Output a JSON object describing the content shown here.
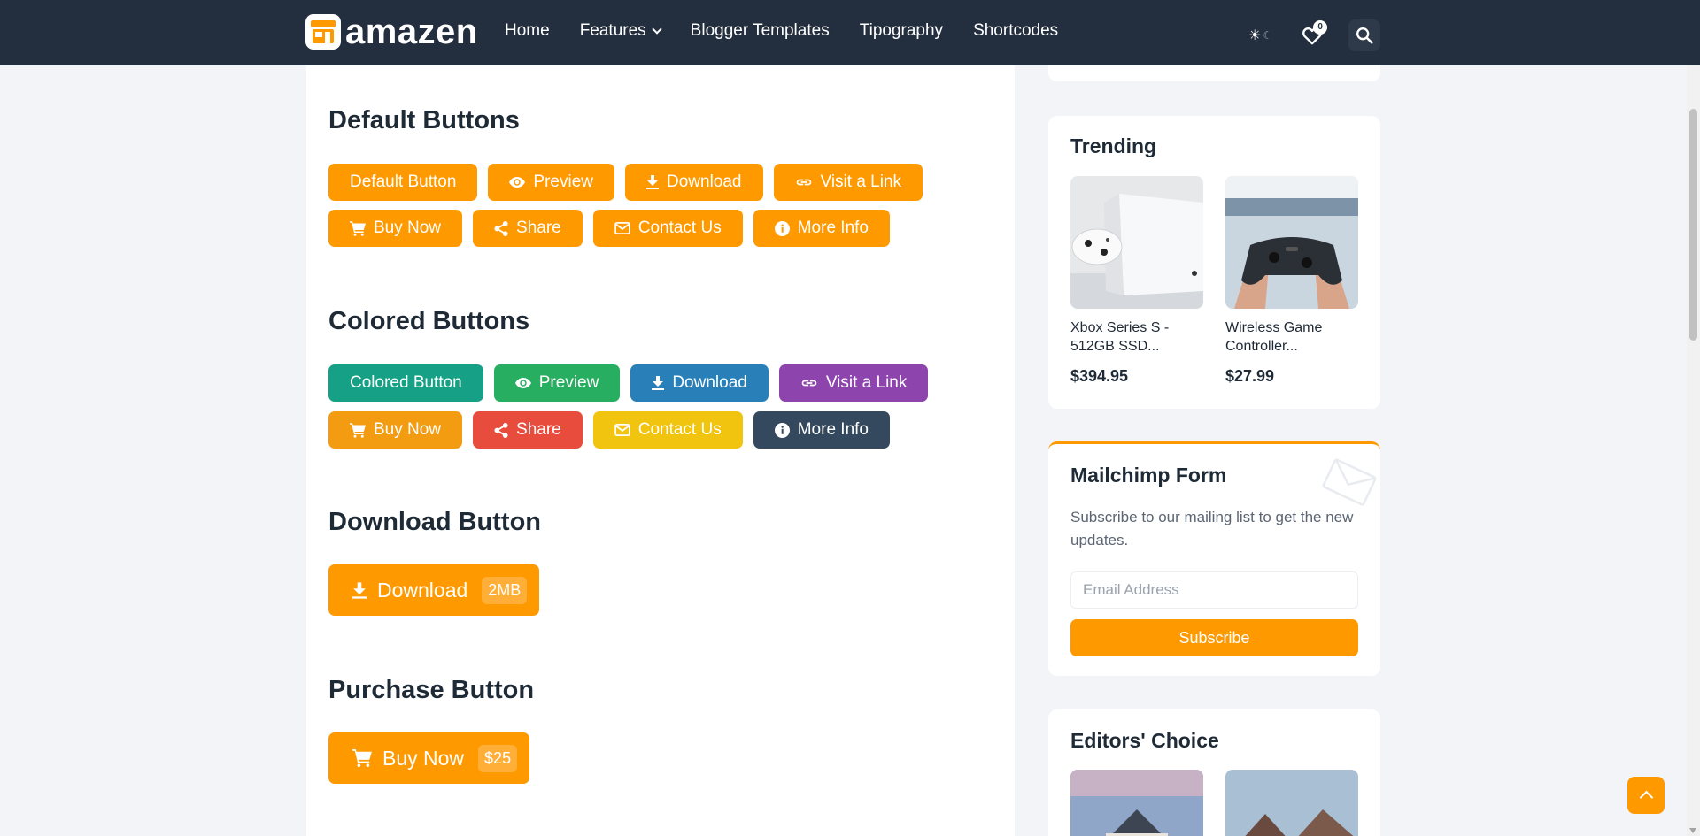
{
  "header": {
    "brand": "amazen",
    "nav": [
      {
        "label": "Home",
        "has_dropdown": false
      },
      {
        "label": "Features",
        "has_dropdown": true
      },
      {
        "label": "Blogger Templates",
        "has_dropdown": false
      },
      {
        "label": "Tipography",
        "has_dropdown": false
      },
      {
        "label": "Shortcodes",
        "has_dropdown": false
      }
    ],
    "wishlist_count": "0",
    "icons": [
      "sun-icon",
      "moon-icon",
      "heart-icon",
      "search-icon"
    ]
  },
  "sections": {
    "default_title": "Default Buttons",
    "default_buttons": [
      "Default Button",
      "Preview",
      "Download",
      "Visit a Link",
      "Buy Now",
      "Share",
      "Contact Us",
      "More Info"
    ],
    "colored_title": "Colored Buttons",
    "colored_buttons": [
      "Colored Button",
      "Preview",
      "Download",
      "Visit a Link",
      "Buy Now",
      "Share",
      "Contact Us",
      "More Info"
    ],
    "download_title": "Download Button",
    "download_button": {
      "label": "Download",
      "size": "2MB"
    },
    "purchase_title": "Purchase Button",
    "purchase_button": {
      "label": "Buy Now",
      "price": "$25"
    }
  },
  "sidebar": {
    "trending": {
      "title": "Trending",
      "items": [
        {
          "name_line1": "Xbox Series S -",
          "name_line2": "512GB SSD...",
          "price": "$394.95"
        },
        {
          "name_line1": "Wireless Game",
          "name_line2": "Controller...",
          "price": "$27.99"
        }
      ]
    },
    "mailchimp": {
      "title": "Mailchimp Form",
      "text": "Subscribe to our mailing list to get the new updates.",
      "email_placeholder": "Email Address",
      "button": "Subscribe"
    },
    "editors": {
      "title": "Editors' Choice"
    }
  },
  "colors": {
    "accent": "#ff9900",
    "header_bg": "#232f3e",
    "teal": "#16a085",
    "green": "#27ae60",
    "blue": "#2980b9",
    "purple": "#8e44ad",
    "red": "#e74c3c",
    "yellow": "#f1c40f",
    "navy": "#34495e"
  }
}
